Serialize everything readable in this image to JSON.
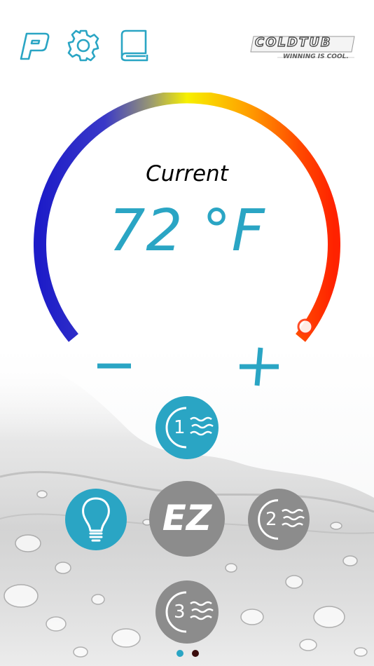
{
  "header": {
    "logo": {
      "name": "COLDTUB",
      "tagline": "WINNING IS COOL."
    },
    "icons": [
      "power-icon",
      "gear-icon",
      "manual-book-icon"
    ]
  },
  "thermostat": {
    "label": "Current",
    "value": "72 °F",
    "decrease_icon": "minus-icon",
    "increase_icon": "plus-icon",
    "gradient": [
      "#1d1cc8",
      "#8a8be0",
      "#f7f000",
      "#ff7a00",
      "#ff2200"
    ]
  },
  "modes": {
    "mode1": {
      "number": "1"
    },
    "mode2": {
      "number": "2"
    },
    "mode3": {
      "number": "3"
    },
    "ez_label": "EZ",
    "light_icon": "light-bulb-icon"
  },
  "colors": {
    "accent": "#2aa5c4",
    "inactive": "#8c8c8c"
  },
  "pager": {
    "pages": 2,
    "current": 1
  }
}
